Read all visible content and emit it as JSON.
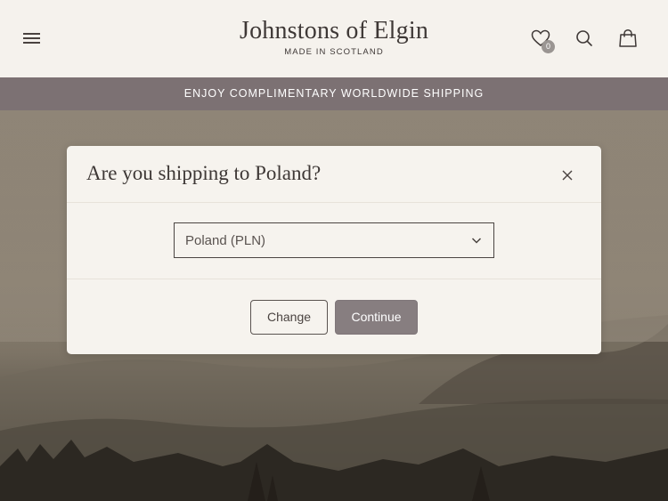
{
  "header": {
    "logo_title": "Johnstons of Elgin",
    "logo_subtitle": "MADE IN SCOTLAND",
    "wishlist_count": "0",
    "icons": [
      "menu-icon",
      "heart-icon",
      "search-icon",
      "bag-icon"
    ]
  },
  "announcement": "ENJOY COMPLIMENTARY WORLDWIDE SHIPPING",
  "modal": {
    "title": "Are you shipping to Poland?",
    "country_selected": "Poland (PLN)",
    "change_label": "Change",
    "continue_label": "Continue"
  },
  "colors": {
    "header_bg": "#f5f2ed",
    "announce_bg": "#7c7173",
    "modal_bg": "#f6f3ee",
    "continue_bg": "#877e80",
    "text_dark": "#3e3836"
  }
}
